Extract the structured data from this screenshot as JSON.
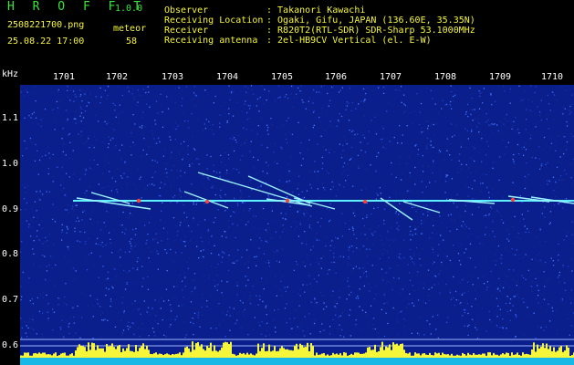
{
  "header": {
    "app_title": "H R O F F T",
    "app_version": "1.0.0",
    "file_name": "2508221700.png",
    "meteor_label": "meteor",
    "date_time": "25.08.22 17:00",
    "meteor_count": "58"
  },
  "info": [
    {
      "key": "Observer",
      "value": ": Takanori Kawachi"
    },
    {
      "key": "Receiving Location",
      "value": ": Ogaki, Gifu, JAPAN (136.60E, 35.35N)"
    },
    {
      "key": "Receiver",
      "value": ": R820T2(RTL-SDR) SDR-Sharp 53.1000MHz"
    },
    {
      "key": "Receiving antenna",
      "value": ": 2el-HB9CV Vertical (el. E-W)"
    }
  ],
  "spectrogram": {
    "unit_label": "kHz",
    "minute_labels": [
      "1701",
      "1702",
      "1703",
      "1704",
      "1705",
      "1706",
      "1707",
      "1708",
      "1709",
      "1710"
    ],
    "freq_labels": [
      "1.1",
      "1.0",
      "0.9",
      "0.8",
      "0.7",
      "0.6"
    ],
    "colors": {
      "background": "#0a1f8c",
      "carrier": "#5ef0ff",
      "echo": "#9cf3ff",
      "echo_hot": "#ff4040",
      "activity": "#f5f53a",
      "baseline": "#18b8e6"
    }
  }
}
